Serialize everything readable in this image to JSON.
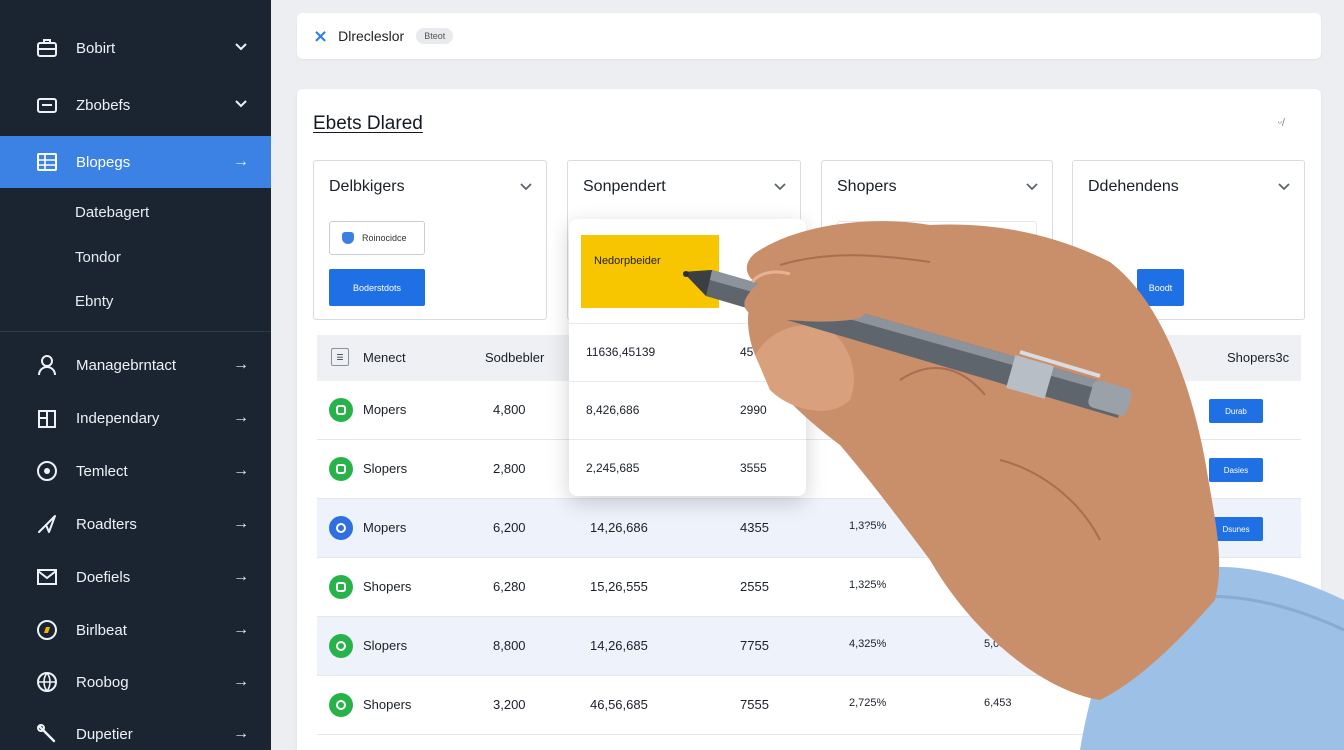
{
  "sidebar": {
    "items": [
      {
        "label": "Bobirt",
        "icon": "briefcase-icon",
        "arrow": "⌄"
      },
      {
        "label": "Zbobefs",
        "icon": "folder-icon",
        "arrow": "⌄"
      },
      {
        "label": "Blopegs",
        "icon": "grid-icon",
        "arrow": "→"
      },
      {
        "label": "Managebrntact",
        "icon": "user-icon",
        "arrow": "→"
      },
      {
        "label": "Independary",
        "icon": "building-icon",
        "arrow": "→"
      },
      {
        "label": "Temlect",
        "icon": "clock-icon",
        "arrow": "→"
      },
      {
        "label": "Roadters",
        "icon": "send-icon",
        "arrow": "→"
      },
      {
        "label": "Doefiels",
        "icon": "mail-icon",
        "arrow": "→"
      },
      {
        "label": "Birlbeat",
        "icon": "compass-icon",
        "arrow": "→"
      },
      {
        "label": "Roobog",
        "icon": "globe-icon",
        "arrow": "→"
      },
      {
        "label": "Dupetier",
        "icon": "wrench-icon",
        "arrow": "→"
      }
    ],
    "subitems": [
      "Datebagert",
      "Tondor",
      "Ebnty"
    ]
  },
  "topbar": {
    "title": "Dlrecleslor",
    "badge": "Bteot"
  },
  "panel": {
    "title": "Ebets Dlared",
    "corner": "ᵕ/"
  },
  "cards": [
    {
      "title": "Delbkigers",
      "outline_label": "Roinocidce",
      "primary_label": "Boderstdots"
    },
    {
      "title": "Sonpendert"
    },
    {
      "title": "Shopers"
    },
    {
      "title": "Ddehendens",
      "primary_label": "Boodt"
    }
  ],
  "popover": {
    "highlight": "Nedorpbeider",
    "rows": [
      {
        "a": "11636,45139",
        "b": "45"
      },
      {
        "a": "8,426,686",
        "b": "2990"
      },
      {
        "a": "2,245,685",
        "b": "3555"
      }
    ]
  },
  "table": {
    "headers": {
      "col1": "Menect",
      "col2": "Sodbebler",
      "last": "Shopers3c"
    },
    "rows": [
      {
        "name": "Mopers",
        "qty": "4,800",
        "amount": "",
        "count": "",
        "pct": "",
        "extra": "",
        "button": "Durab",
        "color": "#27b24a"
      },
      {
        "name": "Slopers",
        "qty": "2,800",
        "amount": "",
        "count": "",
        "pct": "",
        "extra": "",
        "button": "Dasies",
        "color": "#27b24a"
      },
      {
        "name": "Mopers",
        "qty": "6,200",
        "amount": "14,26,686",
        "count": "4355",
        "pct": "1,3?5%",
        "extra": "",
        "button": "Dsunes",
        "color": "#2f6fe0"
      },
      {
        "name": "Shopers",
        "qty": "6,280",
        "amount": "15,26,555",
        "count": "2555",
        "pct": "1,325%",
        "extra": "",
        "button": "",
        "color": "#27b24a"
      },
      {
        "name": "Slopers",
        "qty": "8,800",
        "amount": "14,26,685",
        "count": "7755",
        "pct": "4,325%",
        "extra": "5,032",
        "button": "",
        "color": "#27b24a"
      },
      {
        "name": "Shopers",
        "qty": "3,200",
        "amount": "46,56,685",
        "count": "7555",
        "pct": "2,725%",
        "extra": "6,453",
        "button": "",
        "color": "#27b24a"
      }
    ]
  }
}
